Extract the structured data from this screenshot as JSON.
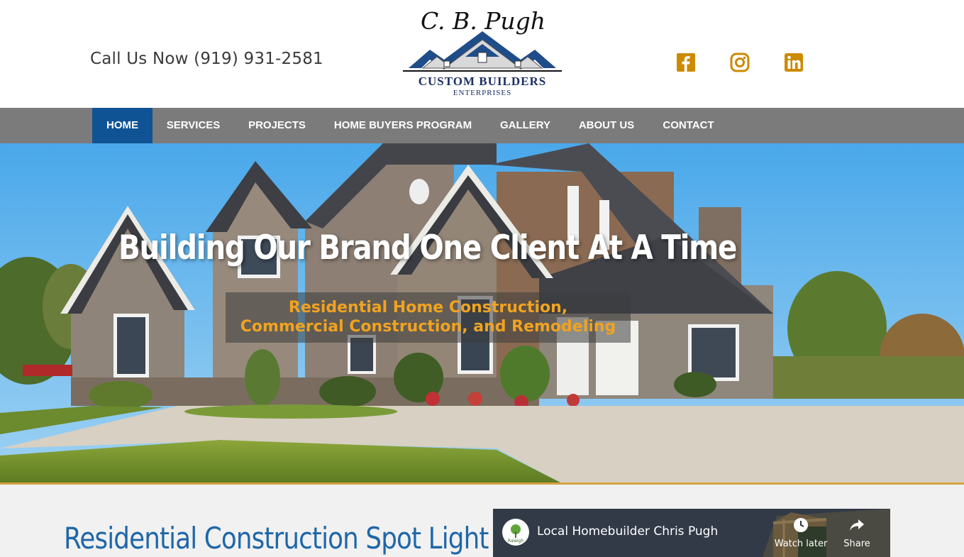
{
  "header": {
    "phone_text": "Call Us Now (919) 931-2581",
    "logo": {
      "script_text": "C. B. Pugh",
      "name_text": "CUSTOM BUILDERS",
      "sub_text": "ENTERPRISES"
    },
    "social": [
      {
        "icon": "facebook-icon"
      },
      {
        "icon": "instagram-icon"
      },
      {
        "icon": "linkedin-icon"
      }
    ],
    "social_color": "#cc8a00"
  },
  "nav": {
    "items": [
      {
        "label": "HOME",
        "active": true
      },
      {
        "label": "SERVICES"
      },
      {
        "label": "PROJECTS"
      },
      {
        "label": "HOME BUYERS PROGRAM"
      },
      {
        "label": "GALLERY"
      },
      {
        "label": "ABOUT US"
      },
      {
        "label": "CONTACT"
      }
    ],
    "bar_color": "#7b7b7b",
    "active_color": "#0f5394"
  },
  "hero": {
    "title": "Building Our Brand One Client At A Time",
    "subtitle_line1": "Residential Home Construction,",
    "subtitle_line2": "Commercial Construction, and Remodeling",
    "accent_color": "#f0a320"
  },
  "content": {
    "spotlight_title": "Residential Construction Spot Light",
    "video": {
      "title": "Local Homebuilder Chris Pugh",
      "channel_badge": "Raleigh",
      "watch_later_label": "Watch later",
      "share_label": "Share"
    }
  }
}
